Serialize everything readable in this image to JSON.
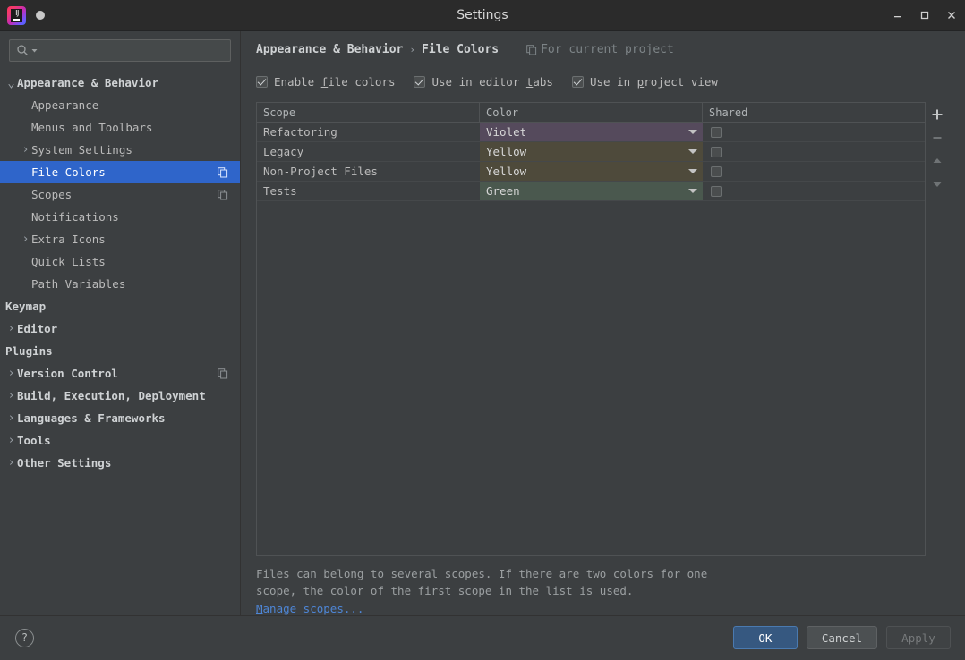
{
  "window": {
    "title": "Settings",
    "minimize_label": "minimize",
    "maximize_label": "maximize",
    "close_label": "close"
  },
  "sidebar": {
    "search": {
      "value": "",
      "placeholder": ""
    },
    "items": [
      {
        "label": "Appearance & Behavior",
        "level": 0,
        "arrow": "down",
        "selected": false,
        "copy": false
      },
      {
        "label": "Appearance",
        "level": 1,
        "arrow": "",
        "selected": false,
        "copy": false
      },
      {
        "label": "Menus and Toolbars",
        "level": 1,
        "arrow": "",
        "selected": false,
        "copy": false
      },
      {
        "label": "System Settings",
        "level": 1,
        "arrow": "right",
        "selected": false,
        "copy": false
      },
      {
        "label": "File Colors",
        "level": 1,
        "arrow": "",
        "selected": true,
        "copy": true
      },
      {
        "label": "Scopes",
        "level": 1,
        "arrow": "",
        "selected": false,
        "copy": true
      },
      {
        "label": "Notifications",
        "level": 1,
        "arrow": "",
        "selected": false,
        "copy": false
      },
      {
        "label": "Extra Icons",
        "level": 1,
        "arrow": "right",
        "selected": false,
        "copy": false
      },
      {
        "label": "Quick Lists",
        "level": 1,
        "arrow": "",
        "selected": false,
        "copy": false
      },
      {
        "label": "Path Variables",
        "level": 1,
        "arrow": "",
        "selected": false,
        "copy": false
      },
      {
        "label": "Keymap",
        "level": 0,
        "arrow": "",
        "selected": false,
        "copy": false
      },
      {
        "label": "Editor",
        "level": 0,
        "arrow": "right",
        "selected": false,
        "copy": false
      },
      {
        "label": "Plugins",
        "level": 0,
        "arrow": "",
        "selected": false,
        "copy": false
      },
      {
        "label": "Version Control",
        "level": 0,
        "arrow": "right",
        "selected": false,
        "copy": true
      },
      {
        "label": "Build, Execution, Deployment",
        "level": 0,
        "arrow": "right",
        "selected": false,
        "copy": false
      },
      {
        "label": "Languages & Frameworks",
        "level": 0,
        "arrow": "right",
        "selected": false,
        "copy": false
      },
      {
        "label": "Tools",
        "level": 0,
        "arrow": "right",
        "selected": false,
        "copy": false
      },
      {
        "label": "Other Settings",
        "level": 0,
        "arrow": "right",
        "selected": false,
        "copy": false
      }
    ]
  },
  "main": {
    "breadcrumb": {
      "root": "Appearance & Behavior",
      "separator": "›",
      "current": "File Colors",
      "project_scope": "For current project"
    },
    "checkboxes": [
      {
        "label_before": "Enable ",
        "mnemonic": "f",
        "label_after": "ile colors",
        "checked": true
      },
      {
        "label_before": "Use in editor ",
        "mnemonic": "t",
        "label_after": "abs",
        "checked": true
      },
      {
        "label_before": "Use in ",
        "mnemonic": "p",
        "label_after": "roject view",
        "checked": true
      }
    ],
    "table": {
      "columns": [
        "Scope",
        "Color",
        "Shared"
      ],
      "rows": [
        {
          "scope": "Refactoring",
          "color": "Violet",
          "swatch": "#554a5c",
          "shared": false
        },
        {
          "scope": "Legacy",
          "color": "Yellow",
          "swatch": "#4e4a3b",
          "shared": false
        },
        {
          "scope": "Non-Project Files",
          "color": "Yellow",
          "swatch": "#4e4a3b",
          "shared": false
        },
        {
          "scope": "Tests",
          "color": "Green",
          "swatch": "#4a584e",
          "shared": false
        }
      ]
    },
    "toolbar": {
      "add": "+",
      "remove": "−",
      "move_up": "move up",
      "move_down": "move down"
    },
    "hint_line1": "Files can belong to several scopes. If there are two colors for one",
    "hint_line2": "scope, the color of the first scope in the list is used.",
    "link": {
      "mnemonic": "M",
      "rest": "anage scopes..."
    }
  },
  "footer": {
    "help": "?",
    "ok": "OK",
    "cancel": "Cancel",
    "apply": "Apply"
  },
  "colors": {
    "accent": "#2f65ca",
    "link": "#4e86d6",
    "primary_button": "#365880",
    "background": "#3c3f41",
    "titlebar": "#2b2b2b"
  }
}
